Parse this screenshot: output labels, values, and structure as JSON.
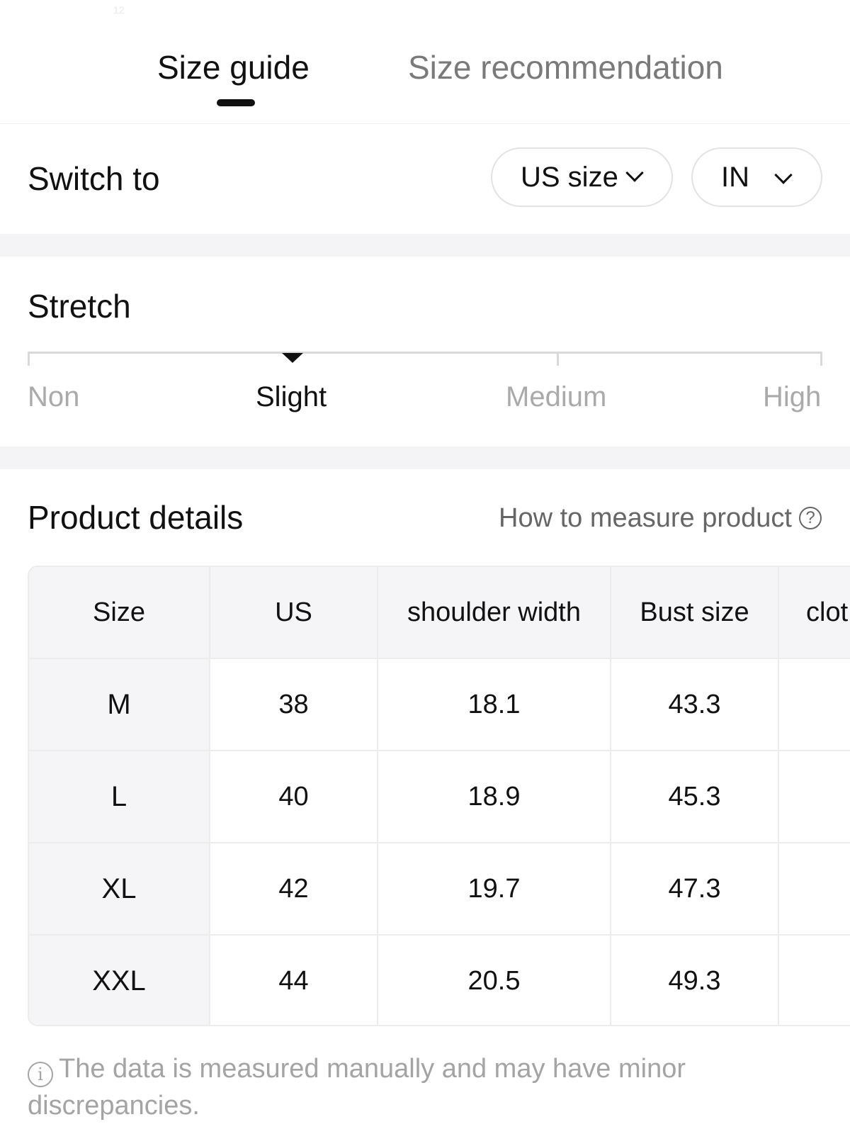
{
  "status_bar": {
    "text": "12"
  },
  "tabs": [
    {
      "label": "Size guide",
      "active": true
    },
    {
      "label": "Size recommendation",
      "active": false
    }
  ],
  "switch": {
    "label": "Switch to",
    "size_system": {
      "selected": "US size"
    },
    "unit": {
      "selected": "IN"
    }
  },
  "stretch": {
    "title": "Stretch",
    "levels": [
      "Non",
      "Slight",
      "Medium",
      "High"
    ],
    "selected_index": 1
  },
  "product_details": {
    "title": "Product details",
    "measure_link": "How to measure product",
    "headers": [
      "Size",
      "US",
      "shoulder width",
      "Bust size",
      "clot"
    ],
    "rows": [
      [
        "M",
        "38",
        "18.1",
        "43.3",
        ""
      ],
      [
        "L",
        "40",
        "18.9",
        "45.3",
        ""
      ],
      [
        "XL",
        "42",
        "19.7",
        "47.3",
        ""
      ],
      [
        "XXL",
        "44",
        "20.5",
        "49.3",
        ""
      ]
    ]
  },
  "note": "The data is measured manually and may have minor discrepancies.",
  "colors": {
    "primary_text": "#111111",
    "muted_text": "#a4a4a4",
    "table_header_bg": "#f5f5f7",
    "band_bg": "#f4f4f6"
  }
}
